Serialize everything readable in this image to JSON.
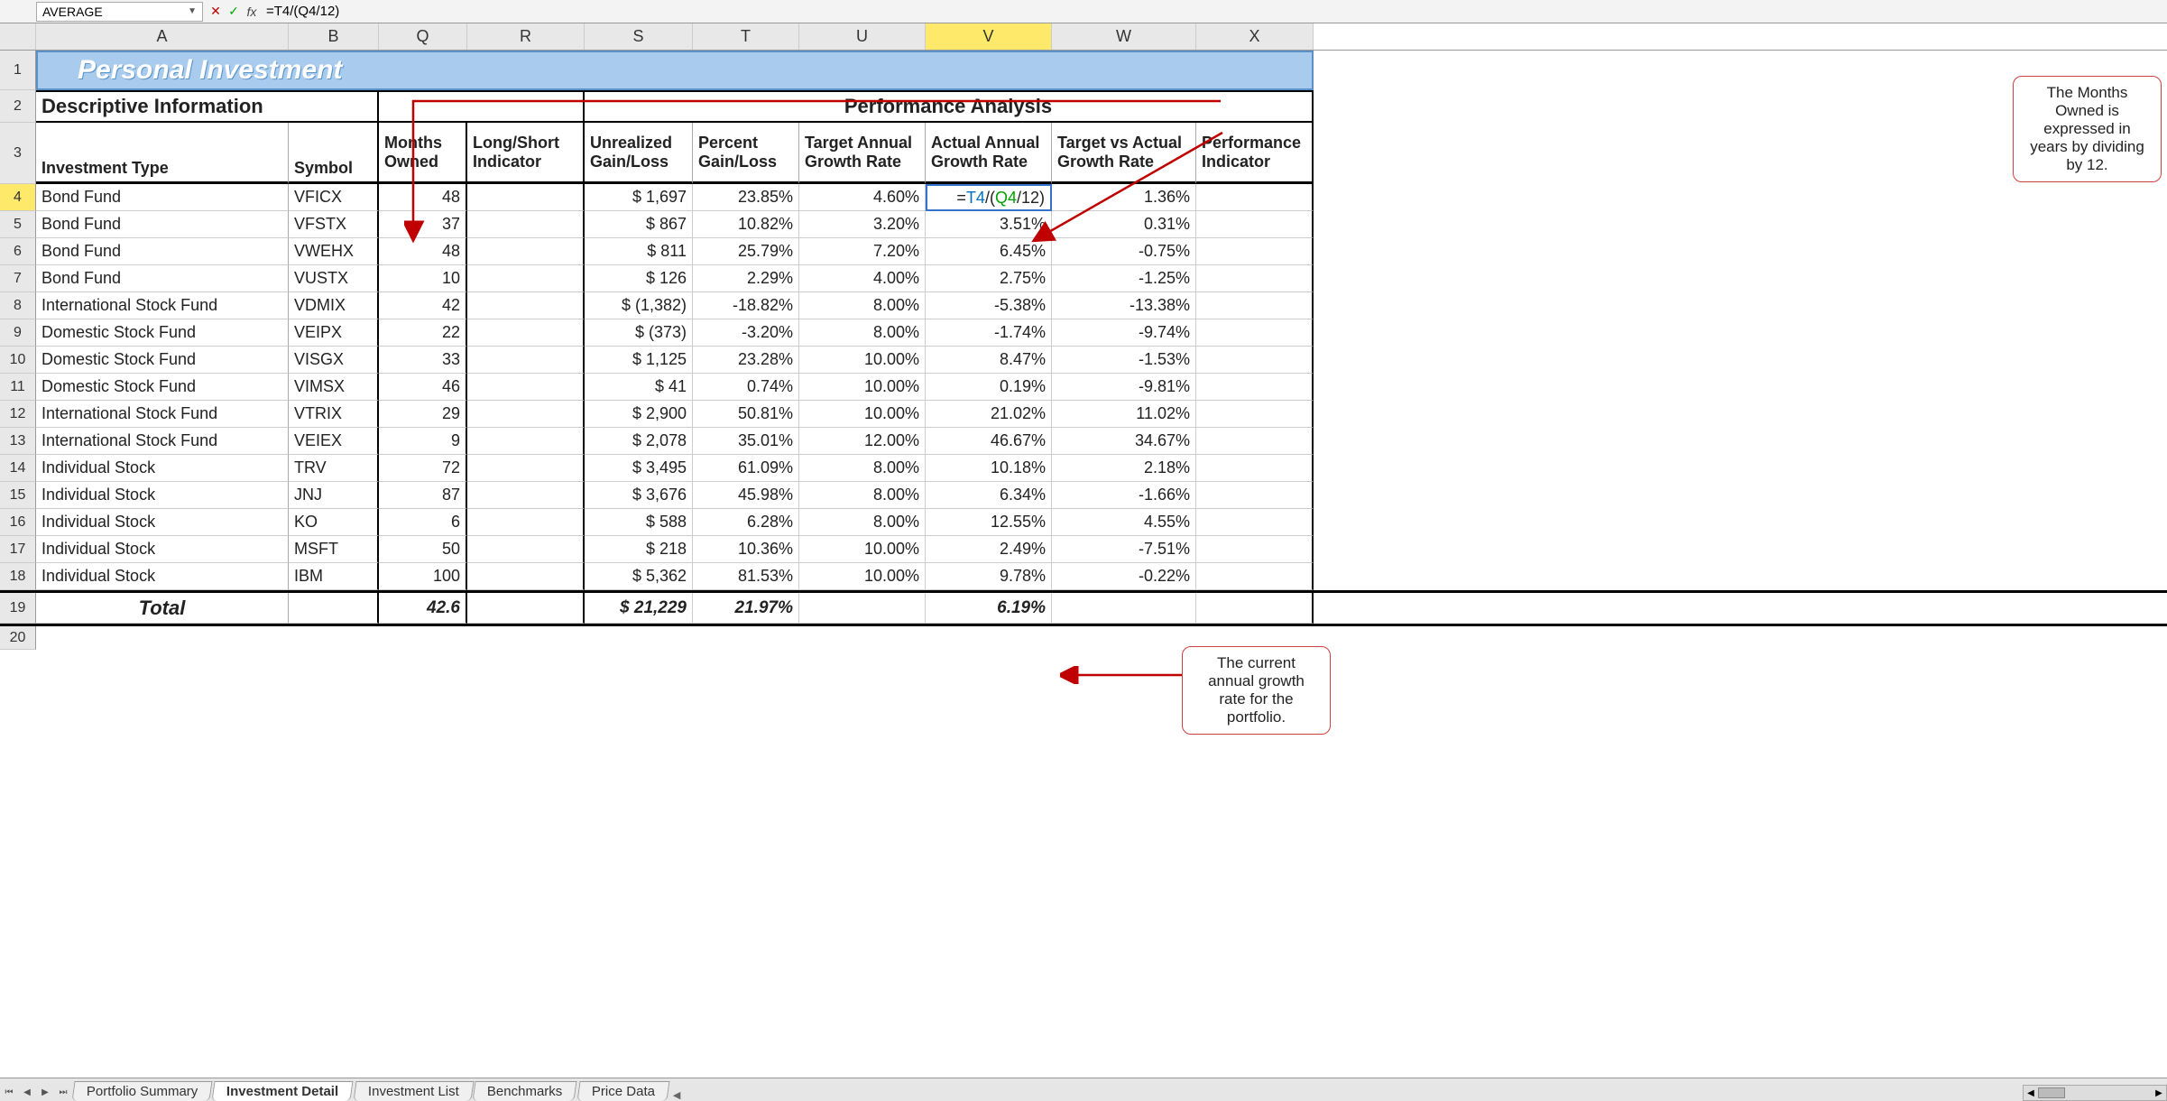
{
  "formula_bar": {
    "name_box": "AVERAGE",
    "formula": "=T4/(Q4/12)"
  },
  "columns": [
    "A",
    "B",
    "Q",
    "R",
    "S",
    "T",
    "U",
    "V",
    "W",
    "X"
  ],
  "highlighted_column": "V",
  "title": "Personal Investment",
  "section_headers": {
    "descriptive": "Descriptive Information",
    "performance": "Performance Analysis"
  },
  "col_headers": {
    "A": "Investment Type",
    "B": "Symbol",
    "Q": "Months Owned",
    "R": "Long/Short Indicator",
    "S": "Unrealized Gain/Loss",
    "T": "Percent Gain/Loss",
    "U": "Target Annual Growth Rate",
    "V": "Actual Annual Growth Rate",
    "W": "Target vs Actual Growth Rate",
    "X": "Performance Indicator"
  },
  "editing_cell": {
    "ref": "V4",
    "display": "=T4/(Q4/12)"
  },
  "rows": [
    {
      "r": 4,
      "type": "Bond Fund",
      "sym": "VFICX",
      "months": "48",
      "ugl": "$   1,697",
      "pgl": "23.85%",
      "tar": "4.60%",
      "act": "=T4/(Q4/12)",
      "tva": "1.36%"
    },
    {
      "r": 5,
      "type": "Bond Fund",
      "sym": "VFSTX",
      "months": "37",
      "ugl": "$      867",
      "pgl": "10.82%",
      "tar": "3.20%",
      "act": "3.51%",
      "tva": "0.31%"
    },
    {
      "r": 6,
      "type": "Bond Fund",
      "sym": "VWEHX",
      "months": "48",
      "ugl": "$      811",
      "pgl": "25.79%",
      "tar": "7.20%",
      "act": "6.45%",
      "tva": "-0.75%"
    },
    {
      "r": 7,
      "type": "Bond Fund",
      "sym": "VUSTX",
      "months": "10",
      "ugl": "$      126",
      "pgl": "2.29%",
      "tar": "4.00%",
      "act": "2.75%",
      "tva": "-1.25%"
    },
    {
      "r": 8,
      "type": "International Stock Fund",
      "sym": "VDMIX",
      "months": "42",
      "ugl": "$  (1,382)",
      "pgl": "-18.82%",
      "tar": "8.00%",
      "act": "-5.38%",
      "tva": "-13.38%"
    },
    {
      "r": 9,
      "type": "Domestic Stock Fund",
      "sym": "VEIPX",
      "months": "22",
      "ugl": "$     (373)",
      "pgl": "-3.20%",
      "tar": "8.00%",
      "act": "-1.74%",
      "tva": "-9.74%"
    },
    {
      "r": 10,
      "type": "Domestic Stock Fund",
      "sym": "VISGX",
      "months": "33",
      "ugl": "$   1,125",
      "pgl": "23.28%",
      "tar": "10.00%",
      "act": "8.47%",
      "tva": "-1.53%"
    },
    {
      "r": 11,
      "type": "Domestic Stock Fund",
      "sym": "VIMSX",
      "months": "46",
      "ugl": "$        41",
      "pgl": "0.74%",
      "tar": "10.00%",
      "act": "0.19%",
      "tva": "-9.81%"
    },
    {
      "r": 12,
      "type": "International Stock Fund",
      "sym": "VTRIX",
      "months": "29",
      "ugl": "$   2,900",
      "pgl": "50.81%",
      "tar": "10.00%",
      "act": "21.02%",
      "tva": "11.02%"
    },
    {
      "r": 13,
      "type": "International Stock Fund",
      "sym": "VEIEX",
      "months": "9",
      "ugl": "$   2,078",
      "pgl": "35.01%",
      "tar": "12.00%",
      "act": "46.67%",
      "tva": "34.67%"
    },
    {
      "r": 14,
      "type": "Individual Stock",
      "sym": "TRV",
      "months": "72",
      "ugl": "$   3,495",
      "pgl": "61.09%",
      "tar": "8.00%",
      "act": "10.18%",
      "tva": "2.18%"
    },
    {
      "r": 15,
      "type": "Individual Stock",
      "sym": "JNJ",
      "months": "87",
      "ugl": "$   3,676",
      "pgl": "45.98%",
      "tar": "8.00%",
      "act": "6.34%",
      "tva": "-1.66%"
    },
    {
      "r": 16,
      "type": "Individual Stock",
      "sym": "KO",
      "months": "6",
      "ugl": "$      588",
      "pgl": "6.28%",
      "tar": "8.00%",
      "act": "12.55%",
      "tva": "4.55%"
    },
    {
      "r": 17,
      "type": "Individual Stock",
      "sym": "MSFT",
      "months": "50",
      "ugl": "$      218",
      "pgl": "10.36%",
      "tar": "10.00%",
      "act": "2.49%",
      "tva": "-7.51%"
    },
    {
      "r": 18,
      "type": "Individual Stock",
      "sym": "IBM",
      "months": "100",
      "ugl": "$   5,362",
      "pgl": "81.53%",
      "tar": "10.00%",
      "act": "9.78%",
      "tva": "-0.22%"
    }
  ],
  "totals": {
    "label": "Total",
    "months": "42.6",
    "ugl": "$ 21,229",
    "pgl": "21.97%",
    "act": "6.19%"
  },
  "sheet_tabs": [
    "Portfolio Summary",
    "Investment Detail",
    "Investment List",
    "Benchmarks",
    "Price Data"
  ],
  "active_tab": "Investment Detail",
  "callouts": {
    "top": "The Months Owned is expressed in years by dividing by 12.",
    "bottom": "The current annual growth rate for the portfolio."
  }
}
